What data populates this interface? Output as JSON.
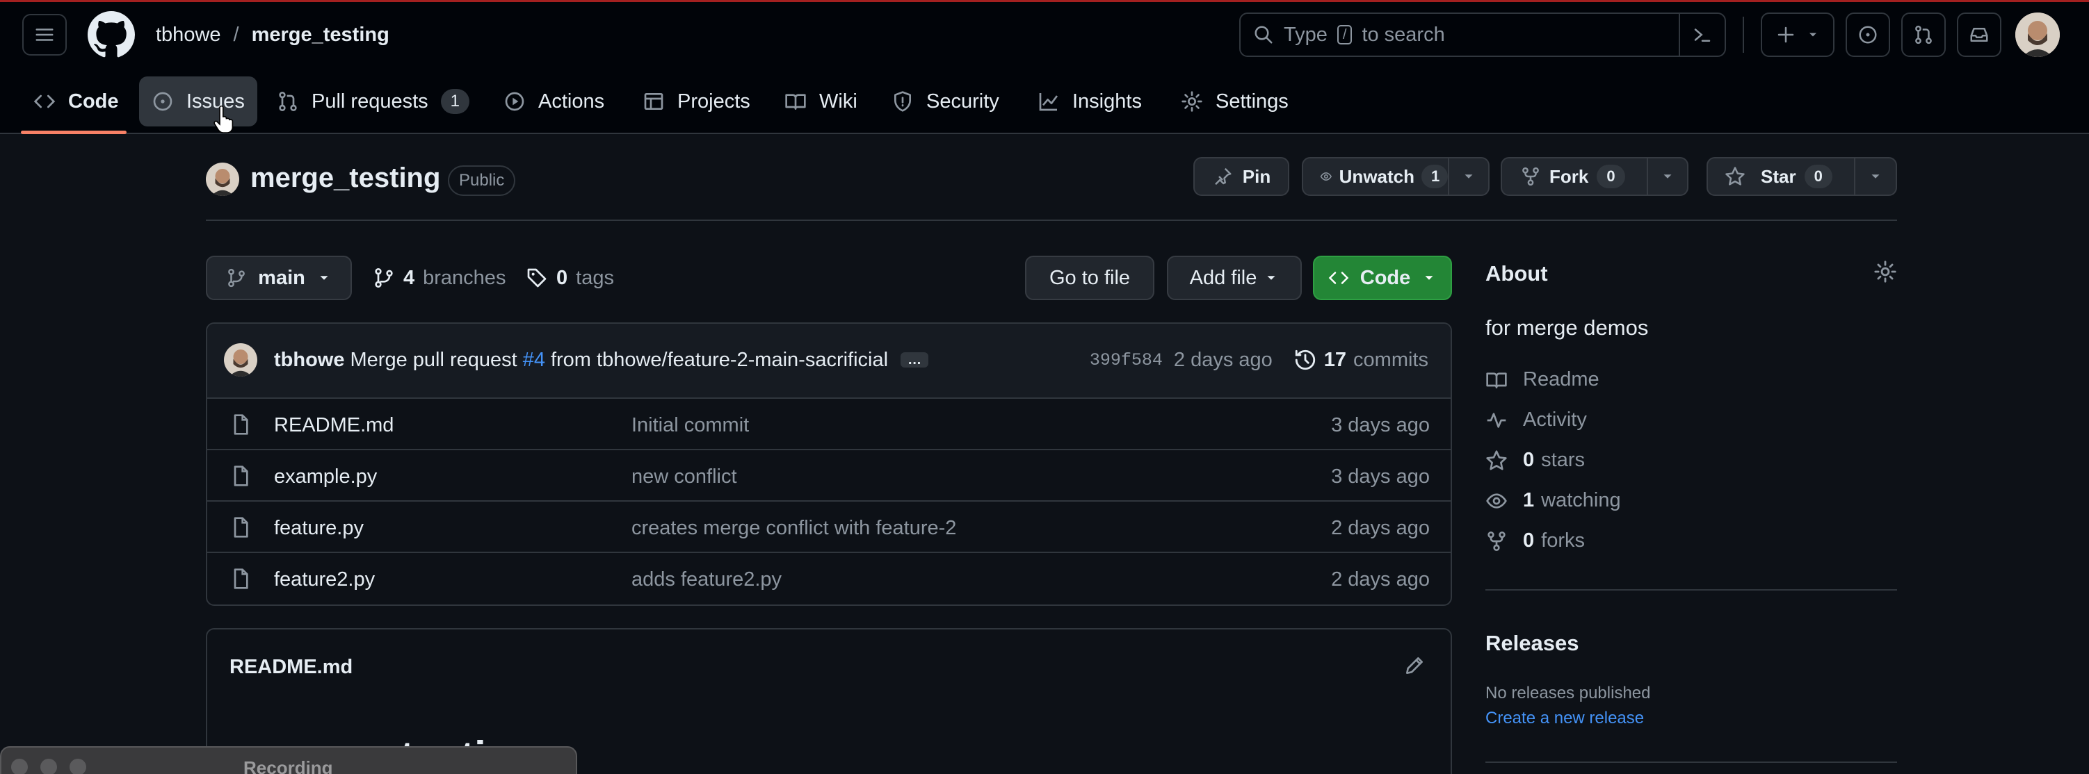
{
  "header": {
    "owner": "tbhowe",
    "separator": "/",
    "repo": "merge_testing",
    "search_placeholder_pre": "Type",
    "search_key": "/",
    "search_placeholder_post": "to search"
  },
  "repo_nav": {
    "code": "Code",
    "issues": "Issues",
    "pull_requests": "Pull requests",
    "pull_requests_count": "1",
    "actions": "Actions",
    "projects": "Projects",
    "wiki": "Wiki",
    "security": "Security",
    "insights": "Insights",
    "settings": "Settings"
  },
  "repo_header": {
    "name": "merge_testing",
    "visibility": "Public",
    "pin": "Pin",
    "unwatch": "Unwatch",
    "unwatch_count": "1",
    "fork": "Fork",
    "fork_count": "0",
    "star": "Star",
    "star_count": "0"
  },
  "toolbar": {
    "branch": "main",
    "branches_count": "4",
    "branches_label": "branches",
    "tags_count": "0",
    "tags_label": "tags",
    "go_to_file": "Go to file",
    "add_file": "Add file",
    "code": "Code"
  },
  "commit": {
    "author": "tbhowe",
    "message_pre": "Merge pull request",
    "pr_link": "#4",
    "message_post": "from tbhowe/feature-2-main-sacrificial",
    "ellipsis": "…",
    "sha": "399f584",
    "time": "2 days ago",
    "commits_count": "17",
    "commits_label": "commits"
  },
  "files": [
    {
      "name": "README.md",
      "message": "Initial commit",
      "date": "3 days ago"
    },
    {
      "name": "example.py",
      "message": "new conflict",
      "date": "3 days ago"
    },
    {
      "name": "feature.py",
      "message": "creates merge conflict with feature-2",
      "date": "2 days ago"
    },
    {
      "name": "feature2.py",
      "message": "adds feature2.py",
      "date": "2 days ago"
    }
  ],
  "readme": {
    "title": "README.md",
    "heading": "merge_testing"
  },
  "about": {
    "title": "About",
    "description": "for merge demos",
    "readme": "Readme",
    "activity": "Activity",
    "stars_count": "0",
    "stars_label": "stars",
    "watching_count": "1",
    "watching_label": "watching",
    "forks_count": "0",
    "forks_label": "forks"
  },
  "releases": {
    "title": "Releases",
    "none": "No releases published",
    "create": "Create a new release"
  },
  "overlay": {
    "recording": "Recording"
  },
  "colors": {
    "accent_green": "#238636",
    "link_blue": "#4493f8",
    "active_tab_underline": "#f78166"
  }
}
